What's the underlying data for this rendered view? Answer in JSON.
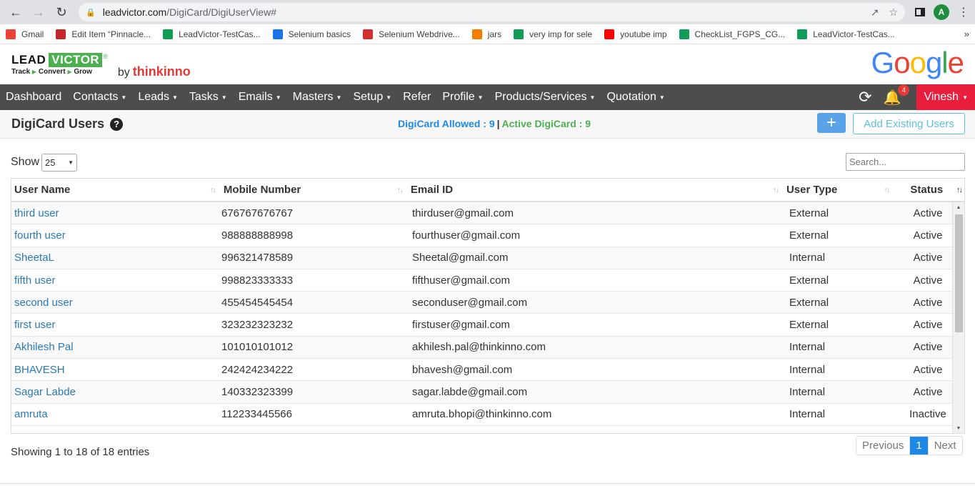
{
  "browser": {
    "url_domain": "leadvictor.com",
    "url_path": "/DigiCard/DigiUserView#",
    "profile_initial": "A",
    "bookmarks": [
      {
        "label": "Gmail",
        "color": "#ea4335"
      },
      {
        "label": "Edit Item “Pinnacle...",
        "color": "#c62828"
      },
      {
        "label": "LeadVictor-TestCas...",
        "color": "#0f9d58"
      },
      {
        "label": "Selenium basics",
        "color": "#1a73e8"
      },
      {
        "label": "Selenium Webdrive...",
        "color": "#d32f2f"
      },
      {
        "label": "jars",
        "color": "#f57c00"
      },
      {
        "label": "very imp for sele",
        "color": "#0f9d58"
      },
      {
        "label": "youtube imp",
        "color": "#ff0000"
      },
      {
        "label": "CheckList_FGPS_CG...",
        "color": "#0f9d58"
      },
      {
        "label": "LeadVictor-TestCas...",
        "color": "#0f9d58"
      }
    ]
  },
  "header": {
    "logo_lead": "LEAD",
    "logo_victor": "VICTOR",
    "logo_reg": "®",
    "tag_track": "Track",
    "tag_convert": "Convert",
    "tag_grow": "Grow",
    "by": "by",
    "brand": "thinkinno",
    "google": [
      "G",
      "o",
      "o",
      "g",
      "l",
      "e"
    ]
  },
  "nav": {
    "items": [
      {
        "label": "Dashboard",
        "caret": false
      },
      {
        "label": "Contacts",
        "caret": true
      },
      {
        "label": "Leads",
        "caret": true
      },
      {
        "label": "Tasks",
        "caret": true
      },
      {
        "label": "Emails",
        "caret": true
      },
      {
        "label": "Masters",
        "caret": true
      },
      {
        "label": "Setup",
        "caret": true
      },
      {
        "label": "Refer",
        "caret": false
      },
      {
        "label": "Profile",
        "caret": true
      },
      {
        "label": "Products/Services",
        "caret": true
      },
      {
        "label": "Quotation",
        "caret": true
      }
    ],
    "notification_count": "4",
    "user": "Vinesh"
  },
  "page": {
    "title": "DigiCard Users",
    "allowed_label": "DigiCard Allowed : 9",
    "separator": "|",
    "active_label": "Active DigiCard : 9",
    "add_button": "+",
    "add_existing": "Add Existing Users"
  },
  "controls": {
    "show_label": "Show",
    "page_size": "25",
    "search_placeholder": "Search..."
  },
  "table": {
    "headers": [
      "User Name",
      "Mobile Number",
      "Email ID",
      "User Type",
      "Status"
    ],
    "rows": [
      [
        "third user",
        "676767676767",
        "thirduser@gmail.com",
        "External",
        "Active"
      ],
      [
        "fourth user",
        "988888888998",
        "fourthuser@gmail.com",
        "External",
        "Active"
      ],
      [
        "SheetaL",
        "996321478589",
        "Sheetal@gmail.com",
        "Internal",
        "Active"
      ],
      [
        "fifth user",
        "998823333333",
        "fifthuser@gmail.com",
        "External",
        "Active"
      ],
      [
        "second user",
        "455454545454",
        "seconduser@gmail.com",
        "External",
        "Active"
      ],
      [
        "first user",
        "323232323232",
        "firstuser@gmail.com",
        "External",
        "Active"
      ],
      [
        "Akhilesh Pal",
        "101010101012",
        "akhilesh.pal@thinkinno.com",
        "Internal",
        "Active"
      ],
      [
        "BHAVESH",
        "242424234222",
        "bhavesh@gmail.com",
        "Internal",
        "Active"
      ],
      [
        "Sagar Labde",
        "140332323399",
        "sagar.labde@gmail.com",
        "Internal",
        "Active"
      ],
      [
        "amruta",
        "112233445566",
        "amruta.bhopi@thinkinno.com",
        "Internal",
        "Inactive"
      ]
    ]
  },
  "footer": {
    "info": "Showing 1 to 18 of 18 entries",
    "previous": "Previous",
    "page": "1",
    "next": "Next"
  }
}
